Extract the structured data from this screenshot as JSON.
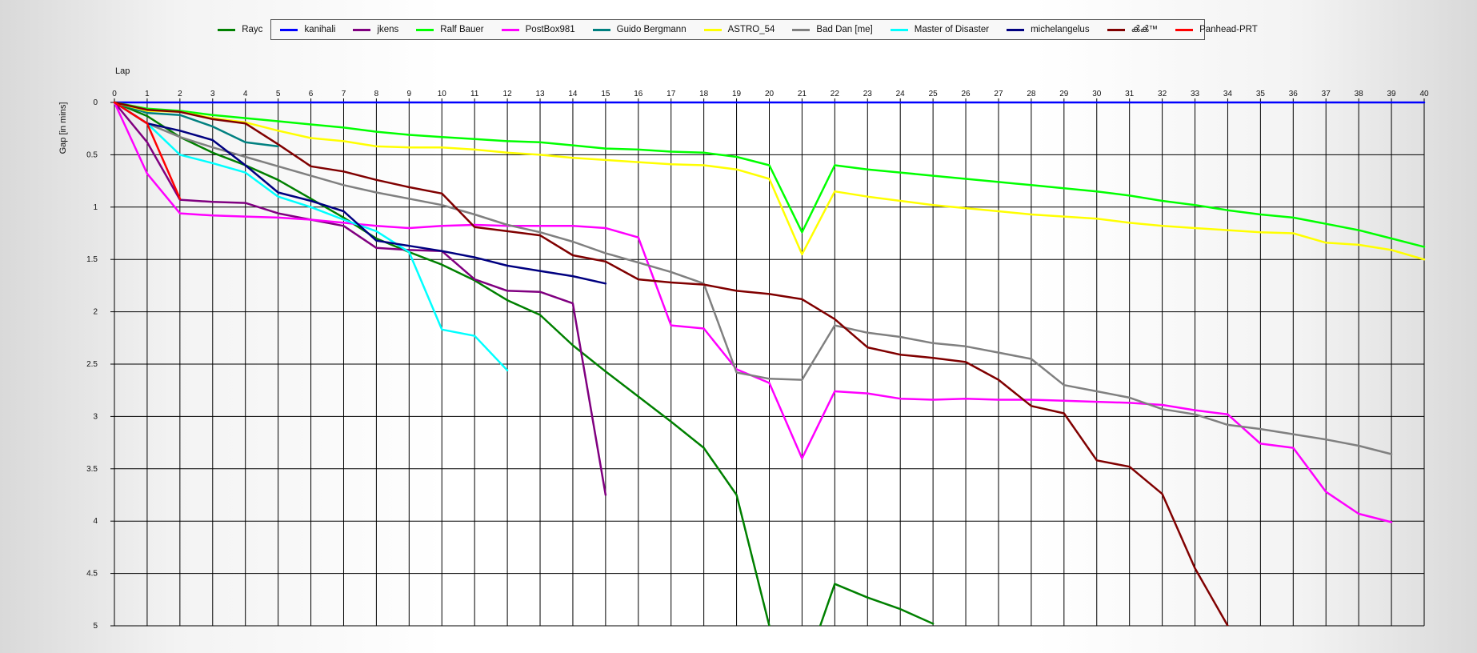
{
  "chart_data": {
    "type": "line",
    "title": "",
    "xlabel": "Lap",
    "ylabel": "Gap [in mins]",
    "xlim": [
      0,
      40
    ],
    "ylim": [
      0,
      5
    ],
    "y_inverted": true,
    "x_axis_position": "top",
    "grid": true,
    "legend_position": "top",
    "x_ticks": [
      0,
      1,
      2,
      3,
      4,
      5,
      6,
      7,
      8,
      9,
      10,
      11,
      12,
      13,
      14,
      15,
      16,
      17,
      18,
      19,
      20,
      21,
      22,
      23,
      24,
      25,
      26,
      27,
      28,
      29,
      30,
      31,
      32,
      33,
      34,
      35,
      36,
      37,
      38,
      39,
      40
    ],
    "y_ticks": [
      "0",
      "0.5",
      "1",
      "1.5",
      "2",
      "2.5",
      "3",
      "3.5",
      "4",
      "4.5",
      "5"
    ],
    "series": [
      {
        "name": "Rayc",
        "color": "#008000",
        "values": [
          0,
          0.13,
          0.33,
          0.48,
          0.6,
          0.74,
          0.92,
          1.1,
          1.3,
          1.43,
          1.55,
          1.7,
          1.89,
          2.03,
          2.32,
          2.57,
          2.81,
          3.05,
          3.3,
          3.75,
          5.0,
          5.5,
          4.6,
          4.73,
          4.84,
          4.98
        ]
      },
      {
        "name": "kanihali",
        "color": "#0000ff",
        "values": [
          0,
          0,
          0,
          0,
          0,
          0,
          0,
          0,
          0,
          0,
          0,
          0,
          0,
          0,
          0,
          0,
          0,
          0,
          0,
          0,
          0,
          0,
          0,
          0,
          0,
          0,
          0,
          0,
          0,
          0,
          0,
          0,
          0,
          0,
          0,
          0,
          0,
          0,
          0,
          0,
          0
        ]
      },
      {
        "name": "jkens",
        "color": "#800080",
        "values": [
          0,
          0.38,
          0.93,
          0.95,
          0.96,
          1.06,
          1.12,
          1.18,
          1.39,
          1.41,
          1.42,
          1.69,
          1.8,
          1.81,
          1.92,
          3.75
        ]
      },
      {
        "name": "Ralf Bauer",
        "color": "#00ff00",
        "values": [
          0,
          0.06,
          0.08,
          0.12,
          0.15,
          0.18,
          0.21,
          0.24,
          0.28,
          0.31,
          0.33,
          0.35,
          0.37,
          0.38,
          0.41,
          0.44,
          0.45,
          0.47,
          0.48,
          0.52,
          0.6,
          1.24,
          0.6,
          0.64,
          0.67,
          0.7,
          0.73,
          0.76,
          0.79,
          0.82,
          0.85,
          0.89,
          0.94,
          0.98,
          1.03,
          1.07,
          1.1,
          1.16,
          1.22,
          1.3,
          1.38
        ]
      },
      {
        "name": "PostBox981",
        "color": "#ff00ff",
        "values": [
          0,
          0.68,
          1.06,
          1.08,
          1.09,
          1.1,
          1.12,
          1.15,
          1.18,
          1.2,
          1.18,
          1.17,
          1.18,
          1.18,
          1.18,
          1.2,
          1.29,
          2.13,
          2.16,
          2.55,
          2.68,
          3.4,
          2.76,
          2.78,
          2.83,
          2.84,
          2.83,
          2.84,
          2.84,
          2.85,
          2.86,
          2.87,
          2.89,
          2.94,
          2.98,
          3.26,
          3.3,
          3.72,
          3.93,
          4.01
        ]
      },
      {
        "name": "Guido Bergmann",
        "color": "#008080",
        "values": [
          0,
          0.1,
          0.12,
          0.23,
          0.38,
          0.42
        ]
      },
      {
        "name": "ASTRO_54",
        "color": "#ffff00",
        "values": [
          0,
          0.08,
          0.09,
          0.15,
          0.19,
          0.27,
          0.34,
          0.37,
          0.42,
          0.43,
          0.43,
          0.45,
          0.48,
          0.5,
          0.53,
          0.55,
          0.57,
          0.59,
          0.6,
          0.64,
          0.73,
          1.45,
          0.85,
          0.9,
          0.94,
          0.98,
          1.01,
          1.04,
          1.07,
          1.09,
          1.11,
          1.15,
          1.18,
          1.2,
          1.22,
          1.24,
          1.25,
          1.34,
          1.36,
          1.41,
          1.5
        ]
      },
      {
        "name": "Bad Dan [me]",
        "color": "#808080",
        "values": [
          0,
          0.2,
          0.33,
          0.43,
          0.52,
          0.61,
          0.7,
          0.79,
          0.86,
          0.92,
          0.98,
          1.07,
          1.17,
          1.24,
          1.33,
          1.44,
          1.53,
          1.62,
          1.73,
          2.58,
          2.64,
          2.65,
          2.13,
          2.2,
          2.24,
          2.3,
          2.33,
          2.39,
          2.45,
          2.7,
          2.76,
          2.82,
          2.93,
          2.98,
          3.08,
          3.12,
          3.17,
          3.22,
          3.28,
          3.36
        ]
      },
      {
        "name": "Master of Disaster",
        "color": "#00ffff",
        "values": [
          0,
          0.2,
          0.5,
          0.58,
          0.67,
          0.9,
          1.0,
          1.12,
          1.23,
          1.43,
          2.17,
          2.23,
          2.56
        ]
      },
      {
        "name": "michelangelus",
        "color": "#000080",
        "values": [
          0,
          0.2,
          0.27,
          0.36,
          0.6,
          0.86,
          0.94,
          1.04,
          1.32,
          1.37,
          1.42,
          1.48,
          1.56,
          1.61,
          1.66,
          1.73
        ]
      },
      {
        "name": "ൿൿ™",
        "color": "#800000",
        "values": [
          0,
          0.07,
          0.09,
          0.16,
          0.2,
          0.4,
          0.61,
          0.66,
          0.74,
          0.81,
          0.87,
          1.19,
          1.23,
          1.27,
          1.46,
          1.52,
          1.69,
          1.72,
          1.74,
          1.8,
          1.83,
          1.88,
          2.07,
          2.34,
          2.41,
          2.44,
          2.48,
          2.65,
          2.9,
          2.97,
          3.42,
          3.48,
          3.74,
          4.45,
          5.0
        ]
      },
      {
        "name": "Panhead-PRT",
        "color": "#ff0000",
        "values": [
          0,
          0.2,
          0.92
        ]
      }
    ]
  }
}
